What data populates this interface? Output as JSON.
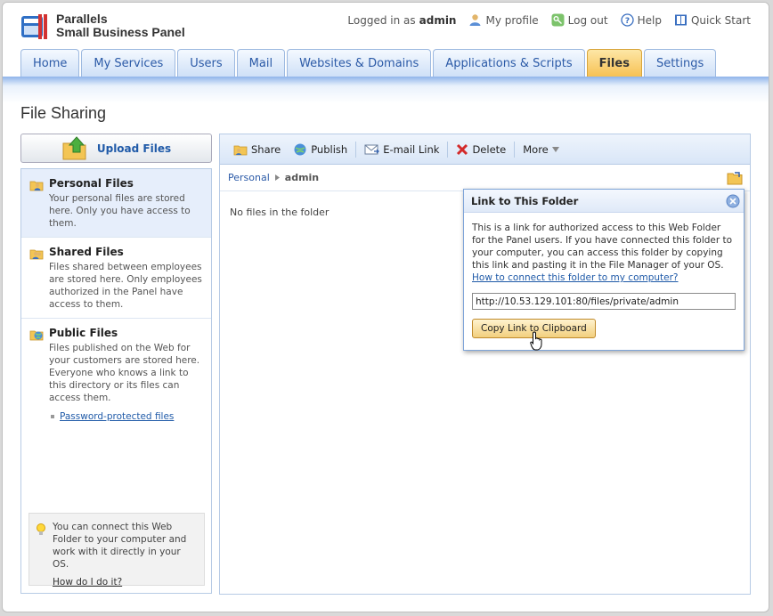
{
  "app": {
    "logo_line1": "Parallels",
    "logo_line2": "Small Business Panel"
  },
  "top_bar": {
    "logged_in_prefix": "Logged in as",
    "username": "admin",
    "my_profile": "My profile",
    "log_out": "Log out",
    "help": "Help",
    "quick_start": "Quick Start"
  },
  "tabs": [
    {
      "label": "Home"
    },
    {
      "label": "My Services"
    },
    {
      "label": "Users"
    },
    {
      "label": "Mail"
    },
    {
      "label": "Websites & Domains"
    },
    {
      "label": "Applications & Scripts"
    },
    {
      "label": "Files",
      "active": true
    },
    {
      "label": "Settings"
    }
  ],
  "page": {
    "title": "File Sharing",
    "upload_label": "Upload Files"
  },
  "sidebar": {
    "items": [
      {
        "title": "Personal Files",
        "desc": "Your personal files are stored here. Only you have access to them.",
        "selected": true
      },
      {
        "title": "Shared Files",
        "desc": "Files shared between employees are stored here. Only employees authorized in the Panel have access to them."
      },
      {
        "title": "Public Files",
        "desc": "Files published on the Web for your customers are stored here. Everyone who knows a link to this directory or its files can access them.",
        "sublink": "Password-protected files"
      }
    ],
    "tip": {
      "text": "You can connect this Web Folder to your computer and work with it directly in your OS.",
      "link": "How do I do it?"
    }
  },
  "toolbar": {
    "share": "Share",
    "publish": "Publish",
    "email_link": "E-mail Link",
    "delete": "Delete",
    "more": "More"
  },
  "breadcrumb": {
    "parent": "Personal",
    "current": "admin"
  },
  "main": {
    "empty_text": "No files in the folder"
  },
  "popup": {
    "title": "Link to This Folder",
    "body": "This is a link for authorized access to this Web Folder for the Panel users. If you have connected this folder to your computer, you can access this folder by copying this link and pasting it in the File Manager of your OS.",
    "help_link": "How to connect this folder to my computer?",
    "url_value": "http://10.53.129.101:80/files/private/admin",
    "copy_button": "Copy Link to Clipboard"
  },
  "colors": {
    "accent_blue": "#2b5aa7",
    "active_tab": "#f7c154",
    "panel_border": "#b7cbe5"
  }
}
